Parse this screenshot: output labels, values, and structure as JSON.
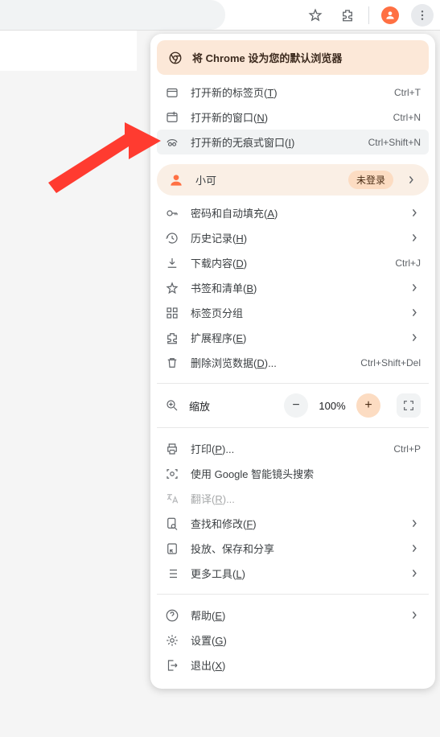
{
  "topbar": {
    "star_title": "bookmark",
    "ext_title": "extensions",
    "profile_title": "profile",
    "more_title": "more"
  },
  "banner": {
    "text": "将 Chrome 设为您的默认浏览器"
  },
  "group1": {
    "new_tab": {
      "label": "打开新的标签页(",
      "u": "T",
      "tail": ")",
      "shortcut": "Ctrl+T"
    },
    "new_window": {
      "label": "打开新的窗口(",
      "u": "N",
      "tail": ")",
      "shortcut": "Ctrl+N"
    },
    "incognito": {
      "label": "打开新的无痕式窗口(",
      "u": "I",
      "tail": ")",
      "shortcut": "Ctrl+Shift+N"
    }
  },
  "profile": {
    "name": "小可",
    "status": "未登录"
  },
  "group2": {
    "passwords": {
      "label": "密码和自动填充(",
      "u": "A",
      "tail": ")"
    },
    "history": {
      "label": "历史记录(",
      "u": "H",
      "tail": ")"
    },
    "downloads": {
      "label": "下载内容(",
      "u": "D",
      "tail": ")",
      "shortcut": "Ctrl+J"
    },
    "bookmarks": {
      "label": "书签和清单(",
      "u": "B",
      "tail": ")"
    },
    "tabgroups": {
      "label": "标签页分组"
    },
    "extensions": {
      "label": "扩展程序(",
      "u": "E",
      "tail": ")"
    },
    "cleardata": {
      "label": "删除浏览数据(",
      "u": "D",
      "tail": ")...",
      "shortcut": "Ctrl+Shift+Del"
    }
  },
  "zoom": {
    "label": "缩放",
    "value": "100%",
    "minus": "−",
    "plus": "+"
  },
  "group3": {
    "print": {
      "label": "打印(",
      "u": "P",
      "tail": ")...",
      "shortcut": "Ctrl+P"
    },
    "lens": {
      "label": "使用 Google 智能镜头搜索"
    },
    "translate": {
      "label": "翻译(",
      "u": "R",
      "tail": ")..."
    },
    "find": {
      "label": "查找和修改(",
      "u": "F",
      "tail": ")"
    },
    "cast": {
      "label": "投放、保存和分享"
    },
    "moretools": {
      "label": "更多工具(",
      "u": "L",
      "tail": ")"
    }
  },
  "group4": {
    "help": {
      "label": "帮助(",
      "u": "E",
      "tail": ")"
    },
    "settings": {
      "label": "设置(",
      "u": "G",
      "tail": ")"
    },
    "exit": {
      "label": "退出(",
      "u": "X",
      "tail": ")"
    }
  }
}
